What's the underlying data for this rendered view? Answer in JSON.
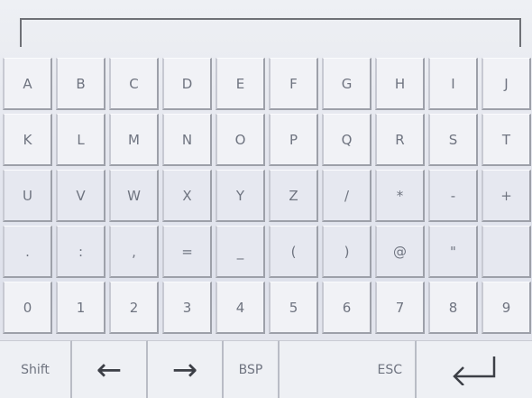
{
  "input": {
    "value": "",
    "placeholder": ""
  },
  "rows": [
    [
      "A",
      "B",
      "C",
      "D",
      "E",
      "F",
      "G",
      "H",
      "I",
      "J"
    ],
    [
      "K",
      "L",
      "M",
      "N",
      "O",
      "P",
      "Q",
      "R",
      "S",
      "T"
    ],
    [
      "U",
      "V",
      "W",
      "X",
      "Y",
      "Z",
      "/",
      "*",
      "-",
      "+"
    ],
    [
      ".",
      ":",
      ",",
      "=",
      "_",
      "(",
      ")",
      "@",
      "\"",
      ""
    ],
    [
      "0",
      "1",
      "2",
      "3",
      "4",
      "5",
      "6",
      "7",
      "8",
      "9"
    ]
  ],
  "bottom": {
    "shift_label": "Shift",
    "left_icon": "left-arrow-icon",
    "right_icon": "right-arrow-icon",
    "bsp_label": "BSP",
    "esc_label": "ESC",
    "enter_icon": "enter-icon"
  }
}
